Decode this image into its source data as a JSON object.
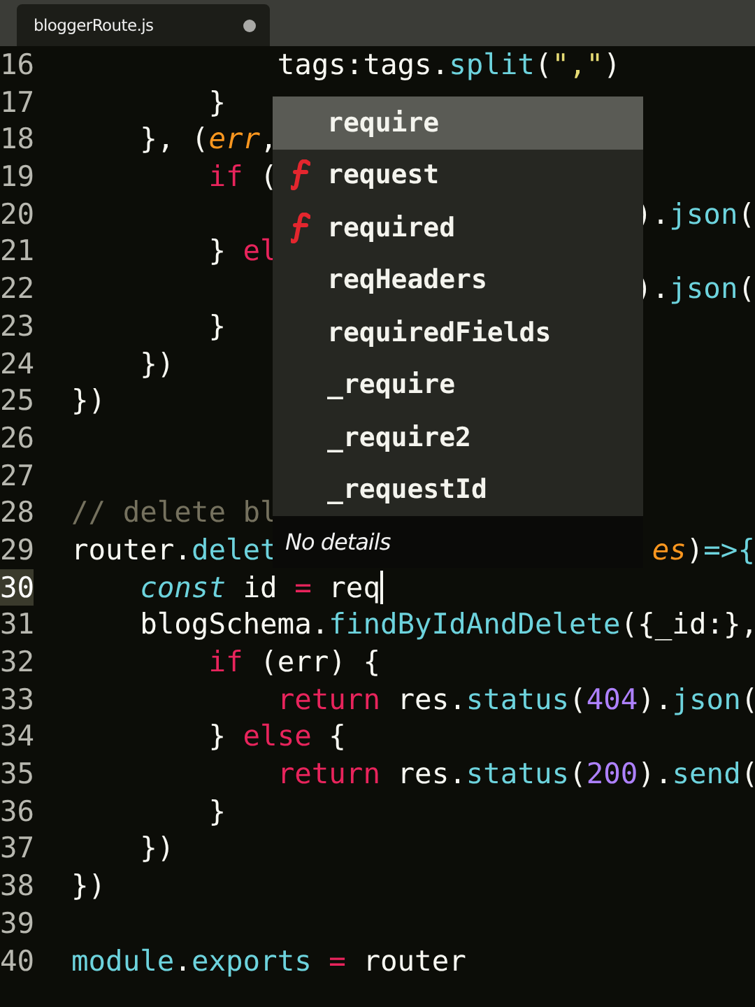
{
  "tab": {
    "title": "bloggerRoute.js",
    "modified": true
  },
  "lines": [
    {
      "children": [
        {
          "children": [
            {
              "children": [
                {
                  "number": "16",
                  "current": false,
                  "tokens": [
                    {
                      "kind": "plain",
                      "text": "tags:tags."
                    },
                    {
                      "kind": "func",
                      "text": "split"
                    },
                    {
                      "kind": "plain",
                      "text": "("
                    },
                    {
                      "kind": "string",
                      "text": "\",\""
                    },
                    {
                      "kind": "plain",
                      "text": ")"
                    }
                  ]
                }
              ]
            },
            {
              "number": "17",
              "current": false,
              "tokens": [
                {
                  "kind": "plain",
                  "text": "}"
                }
              ]
            }
          ]
        },
        {
          "number": "18",
          "current": false,
          "tokens": [
            {
              "kind": "plain",
              "text": "}, ("
            },
            {
              "kind": "param",
              "text": "err"
            },
            {
              "kind": "plain",
              "text": ","
            }
          ]
        },
        {
          "children": [
            {
              "number": "19",
              "current": false,
              "tokens": [
                {
                  "kind": "keyword",
                  "text": "if"
                },
                {
                  "kind": "plain",
                  "text": " ("
                }
              ]
            },
            {
              "number": "20",
              "current": false,
              "right_tokens": [
                {
                  "kind": "plain",
                  "text": ")."
                },
                {
                  "kind": "func",
                  "text": "json"
                },
                {
                  "kind": "plain",
                  "text": "("
                }
              ]
            },
            {
              "number": "21",
              "current": false,
              "tokens": [
                {
                  "kind": "plain",
                  "text": "} "
                },
                {
                  "kind": "keyword",
                  "text": "el"
                }
              ]
            },
            {
              "number": "22",
              "current": false,
              "right_tokens": [
                {
                  "kind": "plain",
                  "text": ")."
                },
                {
                  "kind": "func",
                  "text": "json"
                },
                {
                  "kind": "plain",
                  "text": "("
                }
              ]
            },
            {
              "number": "23",
              "current": false,
              "tokens": [
                {
                  "kind": "plain",
                  "text": "}"
                }
              ]
            }
          ]
        },
        {
          "number": "24",
          "current": false,
          "tokens": [
            {
              "kind": "plain",
              "text": "})"
            }
          ]
        }
      ]
    },
    {
      "number": "25",
      "current": false,
      "tokens": [
        {
          "kind": "plain",
          "text": "})"
        }
      ]
    },
    {
      "number": "26",
      "current": false
    },
    {
      "number": "27",
      "current": false
    },
    {
      "number": "28",
      "current": false,
      "tokens": [
        {
          "kind": "comment",
          "text": "// delete bl"
        }
      ]
    },
    {
      "number": "29",
      "current": false,
      "tokens": [
        {
          "kind": "plain",
          "text": "router."
        },
        {
          "kind": "func",
          "text": "delet"
        }
      ],
      "right_tokens": [
        {
          "kind": "param",
          "text": "es"
        },
        {
          "kind": "plain",
          "text": ")"
        },
        {
          "kind": "func",
          "text": "=>{"
        }
      ]
    },
    {
      "children": [
        {
          "number": "30",
          "current": true,
          "tokens": [
            {
              "kind": "storage",
              "text": "const"
            },
            {
              "kind": "plain",
              "text": " id "
            },
            {
              "kind": "keyword",
              "text": "="
            },
            {
              "kind": "plain",
              "text": " req"
            }
          ]
        },
        {
          "number": "31",
          "current": false,
          "tokens": [
            {
              "kind": "plain",
              "text": "blogSchema."
            },
            {
              "kind": "func",
              "text": "findByIdAndDelete"
            },
            {
              "kind": "plain",
              "text": "({_id:},"
            }
          ]
        },
        {
          "children": [
            {
              "number": "32",
              "current": false,
              "tokens": [
                {
                  "kind": "keyword",
                  "text": "if"
                },
                {
                  "kind": "plain",
                  "text": " (err) {"
                }
              ]
            },
            {
              "children": [
                {
                  "number": "33",
                  "current": false,
                  "tokens": [
                    {
                      "kind": "keyword",
                      "text": "return"
                    },
                    {
                      "kind": "plain",
                      "text": " res."
                    },
                    {
                      "kind": "func",
                      "text": "status"
                    },
                    {
                      "kind": "plain",
                      "text": "("
                    },
                    {
                      "kind": "number",
                      "text": "404"
                    },
                    {
                      "kind": "plain",
                      "text": ")."
                    },
                    {
                      "kind": "func",
                      "text": "json"
                    },
                    {
                      "kind": "plain",
                      "text": "("
                    }
                  ]
                }
              ]
            },
            {
              "number": "34",
              "current": false,
              "tokens": [
                {
                  "kind": "plain",
                  "text": "} "
                },
                {
                  "kind": "keyword",
                  "text": "else"
                },
                {
                  "kind": "plain",
                  "text": " {"
                }
              ]
            },
            {
              "children": [
                {
                  "number": "35",
                  "current": false,
                  "tokens": [
                    {
                      "kind": "keyword",
                      "text": "return"
                    },
                    {
                      "kind": "plain",
                      "text": " res."
                    },
                    {
                      "kind": "func",
                      "text": "status"
                    },
                    {
                      "kind": "plain",
                      "text": "("
                    },
                    {
                      "kind": "number",
                      "text": "200"
                    },
                    {
                      "kind": "plain",
                      "text": ")."
                    },
                    {
                      "kind": "func",
                      "text": "send"
                    },
                    {
                      "kind": "plain",
                      "text": "("
                    }
                  ]
                }
              ]
            },
            {
              "number": "36",
              "current": false,
              "tokens": [
                {
                  "kind": "plain",
                  "text": "}"
                }
              ]
            }
          ]
        },
        {
          "number": "37",
          "current": false,
          "tokens": [
            {
              "kind": "plain",
              "text": "})"
            }
          ]
        }
      ]
    },
    {
      "number": "38",
      "current": false,
      "tokens": [
        {
          "kind": "plain",
          "text": "})"
        }
      ]
    },
    {
      "number": "39",
      "current": false
    },
    {
      "number": "40",
      "current": false,
      "tokens": [
        {
          "kind": "func",
          "text": "module"
        },
        {
          "kind": "plain",
          "text": "."
        },
        {
          "kind": "func",
          "text": "exports"
        },
        {
          "kind": "keyword",
          "text": " ="
        },
        {
          "kind": "plain",
          "text": " router"
        }
      ]
    }
  ],
  "autocomplete": {
    "details": "No details",
    "items": [
      {
        "label": "require",
        "kind": "plain",
        "selected": true
      },
      {
        "label": "request",
        "kind": "function",
        "selected": false
      },
      {
        "label": "required",
        "kind": "function",
        "selected": false
      },
      {
        "label": "reqHeaders",
        "kind": "plain",
        "selected": false
      },
      {
        "label": "requiredFields",
        "kind": "plain",
        "selected": false
      },
      {
        "label": "_require",
        "kind": "plain",
        "selected": false
      },
      {
        "label": "_require2",
        "kind": "plain",
        "selected": false
      },
      {
        "label": "_requestId",
        "kind": "plain",
        "selected": false
      }
    ]
  }
}
